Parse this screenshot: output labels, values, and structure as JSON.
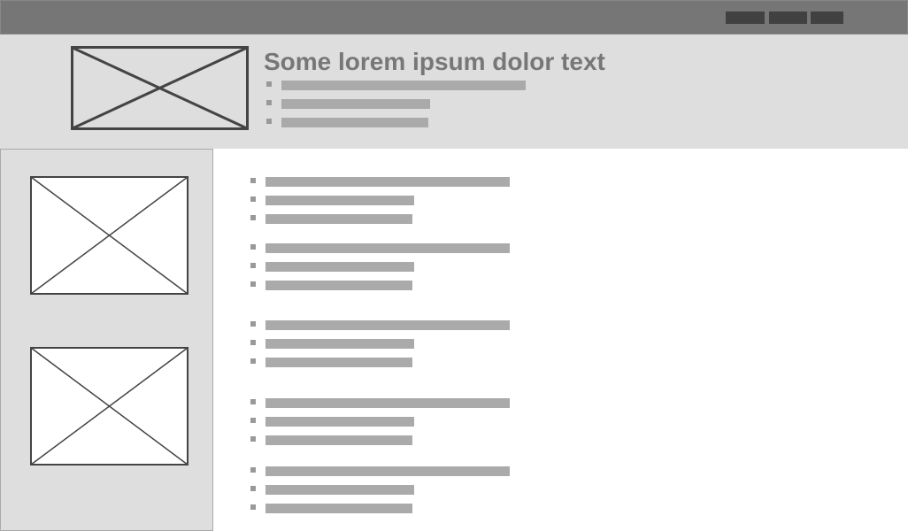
{
  "header": {
    "title": "Some lorem ipsum dolor text"
  },
  "nav": {
    "buttons": [
      "",
      "",
      ""
    ]
  },
  "colors": {
    "nav_bg": "#767676",
    "nav_button": "#414141",
    "panel_bg": "#dedede",
    "text_bar": "#aaaaaa",
    "title_text": "#777777",
    "placeholder_stroke": "#444444"
  },
  "icons": {
    "image_placeholder": "image-placeholder-icon",
    "bullet": "square-bullet"
  }
}
